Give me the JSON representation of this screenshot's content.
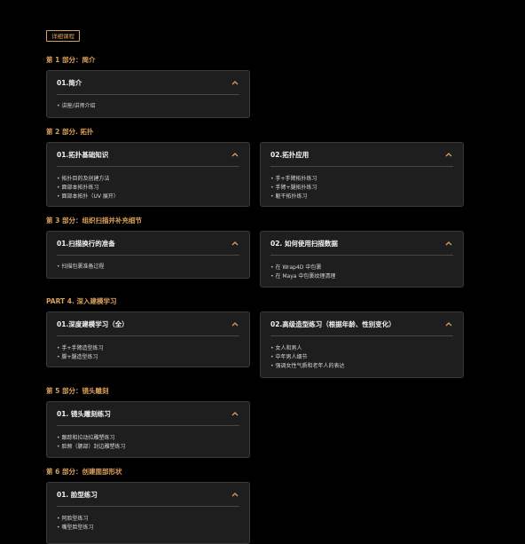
{
  "tag": "详细课程",
  "sections": [
    {
      "title": "第 1 部分：简介"
    },
    {
      "title": "第 2 部分. 拓扑"
    },
    {
      "title": "第 3 部分：组织扫描并补充细节"
    },
    {
      "title": "PART 4. 深入建模学习"
    },
    {
      "title": "第 5 部分：镜头雕刻"
    },
    {
      "title": "第 6 部分：创建面部形状"
    }
  ],
  "cards": [
    {
      "title": "01.简介",
      "items": [
        "讲座/讲师介绍"
      ]
    },
    {
      "title": "01.拓扑基础知识",
      "items": [
        "拓扑目的及创建方法",
        "面部本拓扑练习",
        "面部本拓扑（UV 展开）"
      ]
    },
    {
      "title": "02.拓扑应用",
      "items": [
        "手+手臂拓扑练习",
        "手臂+腿拓扑练习",
        "躯干拓扑练习"
      ]
    },
    {
      "title": "01.扫描换行的准备",
      "items": [
        "扫描包裹准备过程"
      ]
    },
    {
      "title": "02. 如何使用扫描数据",
      "items": [
        "在 Wrap4D 中包裹",
        "在 Maya 中包裹纹理清理"
      ]
    },
    {
      "title": "01.深度建模学习（全）",
      "items": [
        "手+手臂造型练习",
        "脚+腿造型练习"
      ]
    },
    {
      "title": "02.高级造型练习（根据年龄、性别变化）",
      "items": [
        "女人和男人",
        "中年男人细节",
        "强调女性气质和老年人的表达"
      ]
    },
    {
      "title": "01. 镜头雕刻练习",
      "items": [
        "跟踪和拉动拉雕塑练习",
        "脸颊（腮部）封边雕塑练习"
      ]
    },
    {
      "title": "01. 脸型练习",
      "items": [
        "阿脸型练习",
        "嘴型脸型练习"
      ]
    }
  ],
  "colors": {
    "accent": "#d9a05b",
    "card_bg": "#1e1e1e",
    "page_bg": "#000000"
  },
  "icons": {
    "card_toggle": "chevron-up-icon"
  }
}
